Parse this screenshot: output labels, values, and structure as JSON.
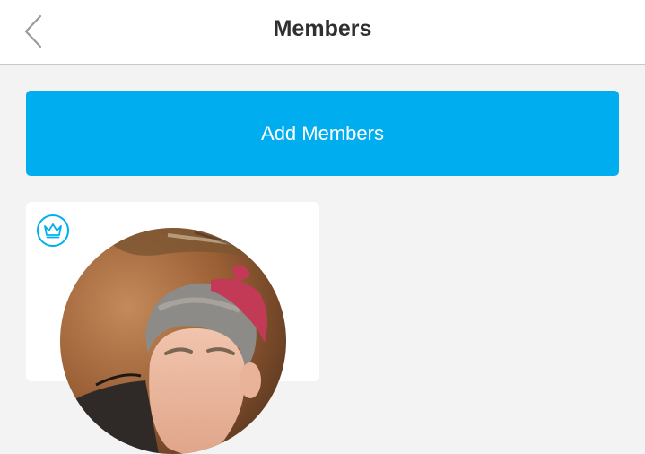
{
  "nav": {
    "title": "Members",
    "back_icon": "chevron-left-icon"
  },
  "add_members": {
    "label": "Add Members"
  },
  "member_card": {
    "badge_icon": "crown-icon",
    "avatar_alt": "member-avatar-photo"
  },
  "colors": {
    "accent": "#00aef0",
    "background": "#f3f3f3",
    "title_text": "#2f2f2f"
  }
}
